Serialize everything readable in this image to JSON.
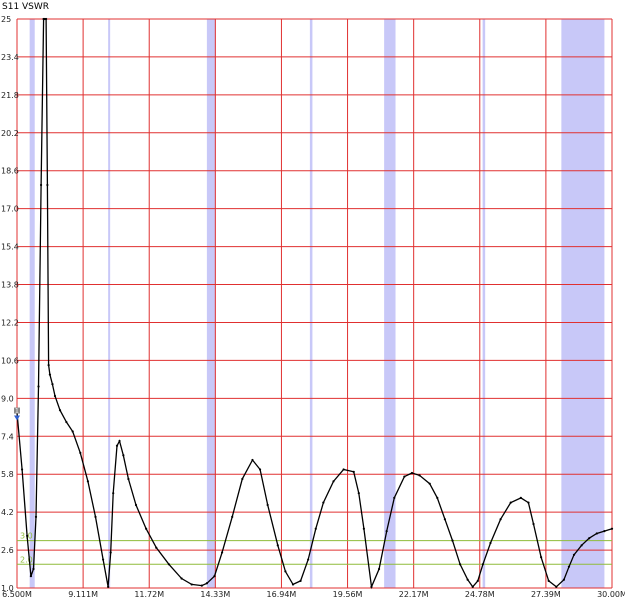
{
  "chart_data": {
    "type": "line",
    "title": "S11 VSWR",
    "xlabel": "",
    "ylabel": "",
    "xlim": [
      6.5,
      30.0
    ],
    "ylim": [
      1.0,
      25.0
    ],
    "x_tick_labels": [
      "6.500M",
      "9.111M",
      "11.72M",
      "14.33M",
      "16.94M",
      "19.56M",
      "22.17M",
      "24.78M",
      "27.39M",
      "30.00M"
    ],
    "y_tick_labels": [
      "1.0",
      "2.6",
      "4.2",
      "5.8",
      "7.4",
      "9.0",
      "10.6",
      "12.2",
      "13.8",
      "15.4",
      "17.0",
      "18.6",
      "20.2",
      "21.8",
      "23.4",
      "25"
    ],
    "grid": true,
    "reference_lines": [
      {
        "label": "3.0",
        "value": 3.0,
        "color": "#8fbc3a"
      },
      {
        "label": "2.0",
        "value": 2.0,
        "color": "#8fbc3a"
      }
    ],
    "band_color": "#c8c8f8",
    "bands_mhz": [
      [
        7.0,
        7.2
      ],
      [
        10.1,
        10.15
      ],
      [
        14.0,
        14.35
      ],
      [
        18.068,
        18.168
      ],
      [
        21.0,
        21.45
      ],
      [
        24.89,
        24.99
      ],
      [
        28.0,
        29.7
      ]
    ],
    "series": [
      {
        "color": "#000000",
        "x": [
          6.5,
          6.7,
          6.9,
          7.05,
          7.15,
          7.25,
          7.35,
          7.45,
          7.55,
          7.6,
          7.65,
          7.7,
          7.75,
          7.8,
          7.9,
          8.0,
          8.2,
          8.45,
          8.7,
          9.0,
          9.3,
          9.6,
          9.9,
          10.1,
          10.2,
          10.3,
          10.45,
          10.55,
          10.7,
          10.9,
          11.2,
          11.6,
          12.0,
          12.5,
          13.0,
          13.4,
          13.8,
          14.0,
          14.3,
          14.6,
          15.0,
          15.4,
          15.8,
          16.1,
          16.4,
          16.8,
          17.1,
          17.4,
          17.7,
          18.0,
          18.3,
          18.6,
          19.0,
          19.4,
          19.8,
          20.0,
          20.2,
          20.5,
          20.8,
          21.1,
          21.4,
          21.8,
          22.1,
          22.4,
          22.8,
          23.1,
          23.4,
          23.7,
          24.0,
          24.3,
          24.5,
          24.7,
          24.9,
          25.2,
          25.6,
          26.0,
          26.4,
          26.7,
          26.9,
          27.2,
          27.5,
          27.8,
          28.1,
          28.3,
          28.5,
          28.8,
          29.1,
          29.4,
          29.7,
          30.0
        ],
        "y": [
          8.4,
          6.0,
          3.2,
          1.5,
          1.8,
          4.0,
          9.5,
          18.0,
          25.0,
          25.0,
          25.0,
          18.0,
          10.4,
          10.0,
          9.6,
          9.1,
          8.5,
          8.0,
          7.6,
          6.7,
          5.5,
          4.0,
          2.2,
          1.05,
          2.5,
          5.0,
          7.0,
          7.2,
          6.6,
          5.6,
          4.5,
          3.5,
          2.7,
          2.0,
          1.4,
          1.15,
          1.1,
          1.2,
          1.5,
          2.5,
          4.0,
          5.6,
          6.4,
          6.0,
          4.5,
          2.8,
          1.7,
          1.15,
          1.3,
          2.2,
          3.5,
          4.6,
          5.5,
          6.0,
          5.9,
          5.0,
          3.5,
          1.05,
          1.8,
          3.4,
          4.8,
          5.7,
          5.85,
          5.75,
          5.4,
          4.8,
          3.9,
          3.0,
          2.0,
          1.35,
          1.05,
          1.3,
          2.0,
          2.9,
          3.9,
          4.6,
          4.8,
          4.6,
          3.7,
          2.3,
          1.3,
          1.05,
          1.35,
          1.9,
          2.4,
          2.8,
          3.1,
          3.3,
          3.4,
          3.5
        ]
      }
    ],
    "markers": [
      {
        "label": "1",
        "x": 6.5,
        "y": 8.4,
        "color": "#888888"
      }
    ]
  }
}
